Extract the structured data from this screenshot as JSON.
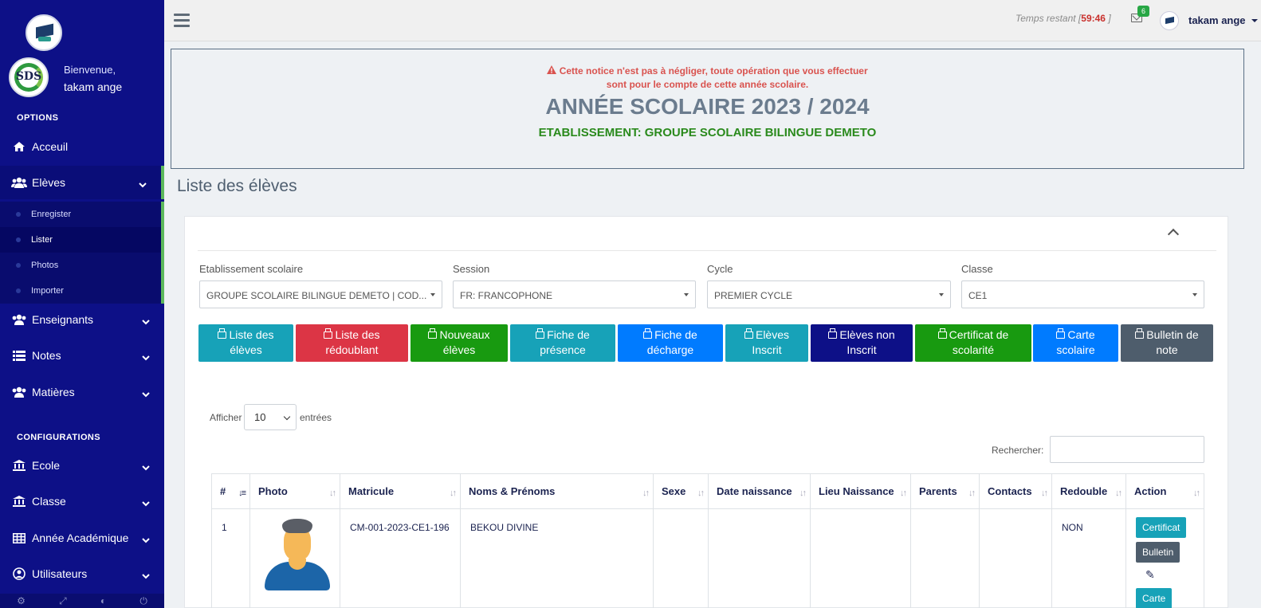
{
  "sidebar": {
    "welcome": "Bienvenue,",
    "user": "takam ange",
    "avatar_text": "SDS",
    "options_heading": "OPTIONS",
    "config_heading": "CONFIGURATIONS",
    "items": [
      {
        "label": "Acceuil",
        "icon": "home-icon"
      },
      {
        "label": "Elèves",
        "icon": "users-icon"
      },
      {
        "label": "Enseignants",
        "icon": "users-icon"
      },
      {
        "label": "Notes",
        "icon": "list-icon"
      },
      {
        "label": "Matières",
        "icon": "users-icon"
      },
      {
        "label": "Ecole",
        "icon": "bank-icon"
      },
      {
        "label": "Classe",
        "icon": "bank-icon"
      },
      {
        "label": "Année Académique",
        "icon": "table-icon"
      },
      {
        "label": "Utilisateurs",
        "icon": "user-circle-icon"
      }
    ],
    "submenu": [
      "Enregister",
      "Lister",
      "Photos",
      "Importer"
    ]
  },
  "topbar": {
    "timer_label": "Temps restant [",
    "timer_value": "59:46",
    "timer_end": "]",
    "mail_count": "6",
    "user": "takam ange"
  },
  "notice": {
    "warning_line1": "Cette notice n'est pas à négliger, toute opération que vous effectuer",
    "warning_line2": "sont pour le compte de cette année scolaire.",
    "year": "ANNÉE SCOLAIRE 2023 / 2024",
    "etablissement": "ETABLISSEMENT: GROUPE SCOLAIRE BILINGUE DEMETO"
  },
  "page_title": "Liste des élèves",
  "filters": [
    {
      "label": "Etablissement scolaire",
      "value": "GROUPE SCOLAIRE BILINGUE DEMETO | COD..."
    },
    {
      "label": "Session",
      "value": "FR: FRANCOPHONE"
    },
    {
      "label": "Cycle",
      "value": "PREMIER CYCLE"
    },
    {
      "label": "Classe",
      "value": "CE1"
    }
  ],
  "buttons": [
    {
      "l1": "Liste des",
      "l2": "élèves",
      "color": "#17a2b8"
    },
    {
      "l1": "Liste des",
      "l2": "rédoublant",
      "color": "#dc3545"
    },
    {
      "l1": "Nouveaux",
      "l2": "élèves",
      "color": "#189a10"
    },
    {
      "l1": "Fiche de",
      "l2": "présence",
      "color": "#17a2b8"
    },
    {
      "l1": "Fiche de",
      "l2": "décharge",
      "color": "#007bff"
    },
    {
      "l1": "Elèves",
      "l2": "Inscrit",
      "color": "#17a2b8"
    },
    {
      "l1": "Elèves non",
      "l2": "Inscrit",
      "color": "#0d1087"
    },
    {
      "l1": "Certificat de",
      "l2": "scolarité",
      "color": "#189a10"
    },
    {
      "l1": "Carte",
      "l2": "scolaire",
      "color": "#007bff"
    },
    {
      "l1": "Bulletin de",
      "l2": "note",
      "color": "#4e5d6c"
    }
  ],
  "table_controls": {
    "show_label": "Afficher",
    "show_value": "10",
    "entries_label": "entrées",
    "search_label": "Rechercher:"
  },
  "table": {
    "headers": [
      "#",
      "Photo",
      "Matricule",
      "Noms & Prénoms",
      "Sexe",
      "Date naissance",
      "Lieu Naissance",
      "Parents",
      "Contacts",
      "Redouble",
      "Action"
    ],
    "rows": [
      {
        "num": "1",
        "matricule": "CM-001-2023-CE1-196",
        "name": "BEKOU DIVINE",
        "sexe": "",
        "date": "",
        "lieu": "",
        "parents": "",
        "contacts": "",
        "redouble": "NON"
      }
    ],
    "actions": [
      "Certificat",
      "Bulletin",
      "Carte"
    ]
  }
}
